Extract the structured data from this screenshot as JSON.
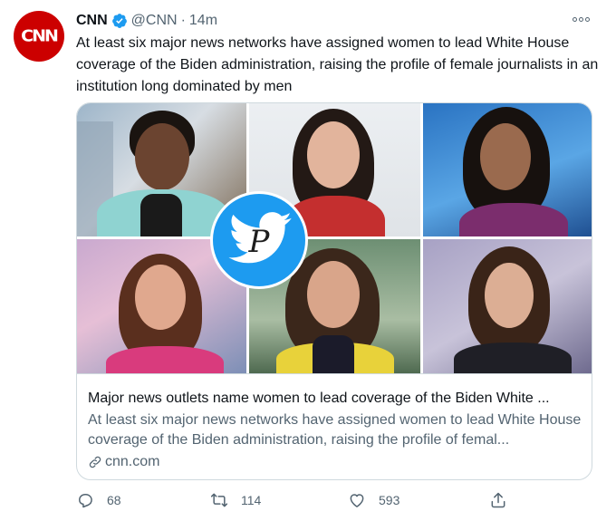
{
  "account": {
    "avatar_text": "CNN",
    "display_name": "CNN",
    "handle": "@CNN",
    "separator": "·",
    "time": "14m",
    "verified": true
  },
  "tweet": {
    "text": "At least six major news networks have assigned women to lead White House coverage of the Biden administration, raising the profile of female journalists in an institution long dominated by men"
  },
  "card": {
    "watermark_letter": "P",
    "title": "Major news outlets name women to lead coverage of the Biden White ...",
    "description": "At least six major news networks have assigned women to lead White House coverage of the Biden administration, raising the profile of femal...",
    "domain": "cnn.com"
  },
  "actions": {
    "reply_count": "68",
    "retweet_count": "114",
    "like_count": "593"
  },
  "colors": {
    "brand_red": "#cc0000",
    "twitter_blue": "#1d9bf0",
    "text_primary": "#0f1419",
    "text_secondary": "#536471",
    "border": "#cfd9de"
  },
  "icons": {
    "verified": "verified-badge-icon",
    "more": "more-options-icon",
    "reply": "reply-icon",
    "retweet": "retweet-icon",
    "like": "heart-icon",
    "share": "share-icon",
    "link": "link-icon"
  }
}
